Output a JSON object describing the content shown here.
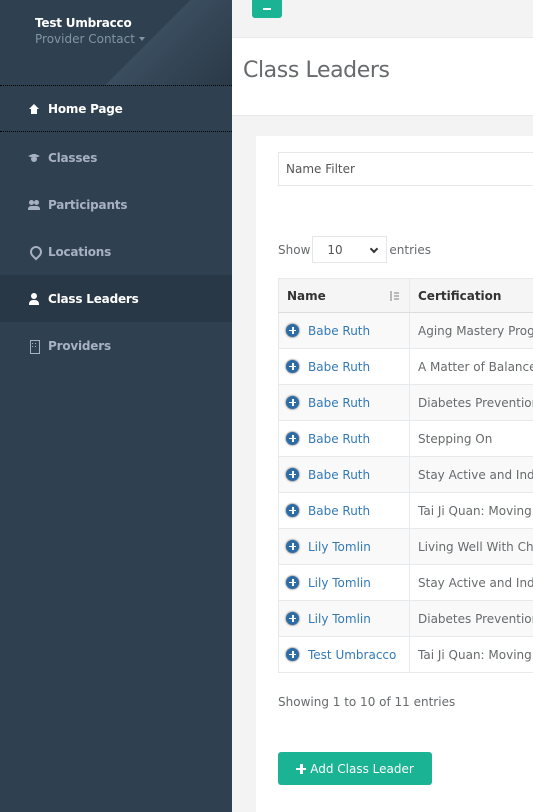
{
  "profile": {
    "name": "Test Umbracco",
    "role": "Provider Contact"
  },
  "nav": {
    "home": "Home Page",
    "classes": "Classes",
    "participants": "Participants",
    "locations": "Locations",
    "class_leaders": "Class Leaders",
    "providers": "Providers"
  },
  "page": {
    "title": "Class Leaders"
  },
  "filter": {
    "placeholder": "Name Filter"
  },
  "length": {
    "show": "Show",
    "value": "10",
    "entries": "entries"
  },
  "table": {
    "headers": {
      "name": "Name",
      "certification": "Certification"
    },
    "rows": [
      {
        "name": "Babe Ruth",
        "cert": "Aging Mastery Program"
      },
      {
        "name": "Babe Ruth",
        "cert": "A Matter of Balance"
      },
      {
        "name": "Babe Ruth",
        "cert": "Diabetes Prevention"
      },
      {
        "name": "Babe Ruth",
        "cert": "Stepping On"
      },
      {
        "name": "Babe Ruth",
        "cert": "Stay Active and Independent"
      },
      {
        "name": "Babe Ruth",
        "cert": "Tai Ji Quan: Moving"
      },
      {
        "name": "Lily Tomlin",
        "cert": "Living Well With Chronic"
      },
      {
        "name": "Lily Tomlin",
        "cert": "Stay Active and Independent"
      },
      {
        "name": "Lily Tomlin",
        "cert": "Diabetes Prevention"
      },
      {
        "name": "Test Umbracco",
        "cert": "Tai Ji Quan: Moving"
      }
    ]
  },
  "info": "Showing 1 to 10 of 11 entries",
  "add_button": "Add Class Leader",
  "colors": {
    "sidebar": "#2f4050",
    "accent": "#1ab394",
    "link": "#337ab7"
  }
}
